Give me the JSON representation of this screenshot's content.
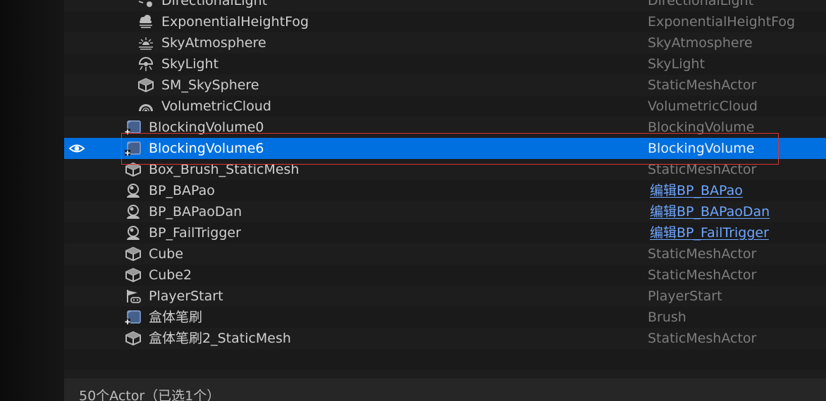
{
  "rows": [
    {
      "label": "DirectionalLight",
      "type": "DirectionalLight",
      "icon": "directional-light-icon"
    },
    {
      "label": "ExponentialHeightFog",
      "type": "ExponentialHeightFog",
      "icon": "fog-icon"
    },
    {
      "label": "SkyAtmosphere",
      "type": "SkyAtmosphere",
      "icon": "sky-atmosphere-icon"
    },
    {
      "label": "SkyLight",
      "type": "SkyLight",
      "icon": "skylight-icon"
    },
    {
      "label": "SM_SkySphere",
      "type": "StaticMeshActor",
      "icon": "static-mesh-icon"
    },
    {
      "label": "VolumetricCloud",
      "type": "VolumetricCloud",
      "icon": "volumetric-cloud-icon"
    },
    {
      "label": "BlockingVolume0",
      "type": "BlockingVolume",
      "icon": "volume-icon"
    },
    {
      "label": "BlockingVolume6",
      "type": "BlockingVolume",
      "icon": "volume-icon",
      "selected": true
    },
    {
      "label": "Box_Brush_StaticMesh",
      "type": "StaticMeshActor",
      "icon": "static-mesh-icon"
    },
    {
      "label": "BP_BAPao",
      "type": "编辑BP_BAPao",
      "icon": "pawn-icon",
      "link": true
    },
    {
      "label": "BP_BAPaoDan",
      "type": "编辑BP_BAPaoDan",
      "icon": "pawn-icon",
      "link": true
    },
    {
      "label": "BP_FailTrigger",
      "type": "编辑BP_FailTrigger",
      "icon": "pawn-icon",
      "link": true
    },
    {
      "label": "Cube",
      "type": "StaticMeshActor",
      "icon": "static-mesh-icon"
    },
    {
      "label": "Cube2",
      "type": "StaticMeshActor",
      "icon": "static-mesh-icon"
    },
    {
      "label": "PlayerStart",
      "type": "PlayerStart",
      "icon": "player-start-icon"
    },
    {
      "label": "盒体笔刷",
      "type": "Brush",
      "icon": "volume-icon"
    },
    {
      "label": "盒体笔刷2_StaticMesh",
      "type": "StaticMeshActor",
      "icon": "static-mesh-icon"
    },
    {
      "label": "",
      "type": "",
      "icon": ""
    },
    {
      "label": "",
      "type": "",
      "icon": ""
    }
  ],
  "status": {
    "text": "50个Actor（已选1个）"
  },
  "colors": {
    "selection": "#0070e0",
    "highlight_box": "#e03434",
    "link": "#6ea6ff"
  }
}
